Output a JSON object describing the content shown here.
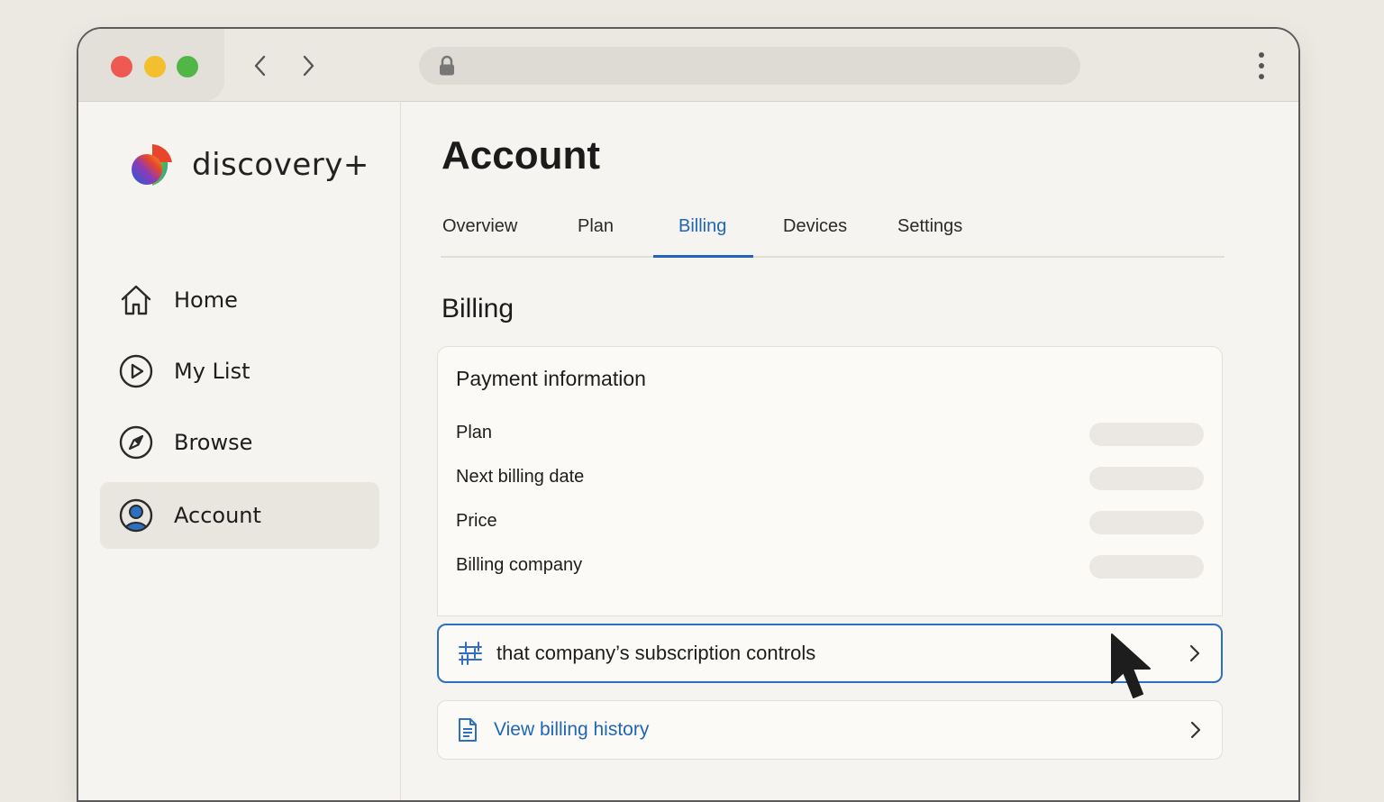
{
  "browser": {
    "icons": {
      "back": "chevron-left-icon",
      "forward": "chevron-right-icon",
      "lock": "lock-icon",
      "menu": "more-vertical-icon"
    }
  },
  "brand": {
    "name": "discovery+"
  },
  "sidebar": {
    "items": [
      {
        "label": "Home",
        "icon": "home-icon"
      },
      {
        "label": "My List",
        "icon": "play-circle-icon"
      },
      {
        "label": "Browse",
        "icon": "compass-icon"
      },
      {
        "label": "Account",
        "icon": "user-circle-icon",
        "active": true
      }
    ]
  },
  "main": {
    "title": "Account",
    "tabs": [
      {
        "label": "Overview"
      },
      {
        "label": "Plan"
      },
      {
        "label": "Billing",
        "active": true
      },
      {
        "label": "Devices"
      },
      {
        "label": "Settings"
      }
    ],
    "section_title": "Billing",
    "payment": {
      "title": "Payment information",
      "rows": [
        {
          "label": "Plan"
        },
        {
          "label": "Next billing date"
        },
        {
          "label": "Price"
        },
        {
          "label": "Billing company"
        }
      ]
    },
    "controls_link": {
      "label": "that company’s subscription controls",
      "icon": "sliders-icon"
    },
    "history_link": {
      "label": "View billing history",
      "icon": "document-icon"
    }
  },
  "colors": {
    "accent": "#1f66b8",
    "window_bg": "#f6f4f0",
    "page_bg": "#ece9e2"
  }
}
